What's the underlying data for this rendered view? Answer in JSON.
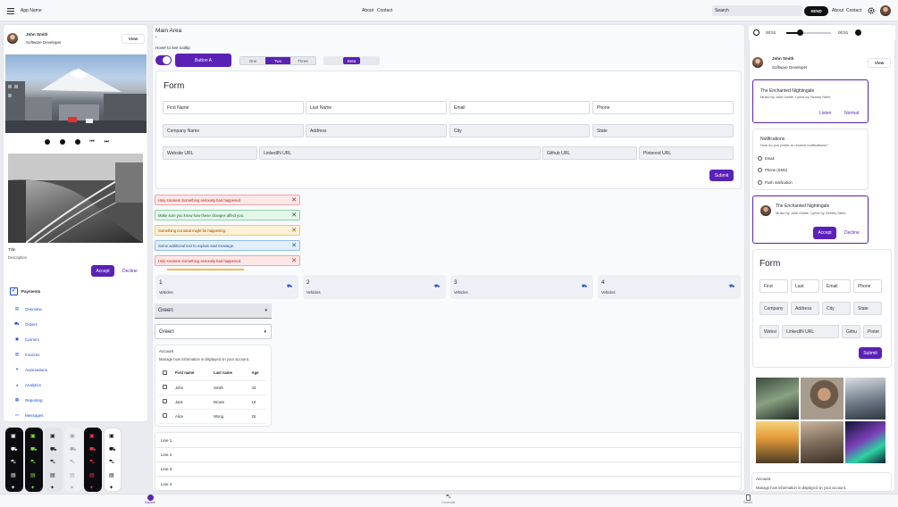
{
  "topbar": {
    "app_name": "App Name",
    "links": [
      "About",
      "Contact"
    ],
    "search_placeholder": "Search",
    "send_label": "SEND",
    "right_links": [
      "About",
      "Contact"
    ]
  },
  "profile": {
    "name": "John Smith",
    "role": "Software Developer",
    "view_label": "View"
  },
  "image_card": {
    "title": "Title",
    "description": "Description",
    "accept_label": "Accept",
    "decline_label": "Decline"
  },
  "nav": {
    "header": "Payments",
    "items": [
      "Overview",
      "Orders",
      "Carriers",
      "Invoices",
      "Automations",
      "Analytics",
      "Reporting",
      "Messages"
    ]
  },
  "main": {
    "title": "Main Area",
    "breadcrumb": "‹",
    "tooltip_hint": "Hover to see tooltip",
    "button_a": "Button A",
    "segmented": [
      "One",
      "Two",
      "Three"
    ],
    "segmented_selected": "Two",
    "beta_label": "Beta",
    "form": {
      "title": "Form",
      "row1": [
        "First Name",
        "Last Name",
        "Email",
        "Phone"
      ],
      "row2": [
        "Company Name",
        "Address",
        "City",
        "State"
      ],
      "row3": [
        "Website URL",
        "LinkedIN URL",
        "Github URL",
        "Pinterest URL"
      ],
      "submit": "Submit"
    },
    "alerts": [
      {
        "text": "Holy smokes! Something seriously bad happened.",
        "type": "error"
      },
      {
        "text": "Make sure you know how these changes affect you.",
        "type": "success"
      },
      {
        "text": "Something not ideal might be happening.",
        "type": "warning"
      },
      {
        "text": "Some additional text to explain said message.",
        "type": "info"
      },
      {
        "text": "Holy smokes! Something seriously bad happened.",
        "type": "error"
      }
    ],
    "stats": [
      {
        "value": "1",
        "label": "Vehicles"
      },
      {
        "value": "2",
        "label": "Vehicles"
      },
      {
        "value": "3",
        "label": "Vehicles"
      },
      {
        "value": "4",
        "label": "Vehicles"
      }
    ],
    "selects": [
      "Green",
      "Green"
    ],
    "account": {
      "title": "Account",
      "desc": "Manage how information is displayed on your account.",
      "headers": [
        "First name",
        "Last name",
        "Age"
      ],
      "rows": [
        [
          "John",
          "Smith",
          "43"
        ],
        [
          "Jack",
          "Brown",
          "19"
        ],
        [
          "Alice",
          "Wong",
          "25"
        ]
      ]
    },
    "lines": [
      "Line 1",
      "Line 2",
      "Line 3",
      "Line 4"
    ]
  },
  "right": {
    "player": {
      "time_start": "00:51",
      "time_end": "00:51",
      "progress": 0.3
    },
    "profile": {
      "name": "John Smith",
      "role": "Software Developer",
      "view_label": "View"
    },
    "song_card": {
      "title": "The Enchanted Nightingale",
      "desc": "Music by Julie Gable. Lyrics by Sidney Stein.",
      "listen": "Listen",
      "normal": "Normal"
    },
    "notifications": {
      "title": "Notifications",
      "desc": "How do you prefer to receive notifications?",
      "options": [
        "Email",
        "Phone (SMS)",
        "Push notification"
      ]
    },
    "song_card2": {
      "title": "The Enchanted Nightingale",
      "desc": "Music by Julie Gable. Lyrics by Sidney Stein.",
      "accept": "Accept",
      "decline": "Decline"
    },
    "mini_form": {
      "title": "Form",
      "row1": [
        "First",
        "Last",
        "Email",
        "Phone"
      ],
      "row2": [
        "Company",
        "Address",
        "City",
        "State"
      ],
      "row3": [
        "Websi",
        "LinkedIN URL",
        "Githu",
        "Pinter"
      ],
      "submit": "Submit"
    },
    "account": {
      "title": "Account",
      "desc": "Manage how information is displayed on your account."
    }
  },
  "bottom_nav": {
    "items": [
      "Explore",
      "Commute",
      "Saved"
    ]
  }
}
